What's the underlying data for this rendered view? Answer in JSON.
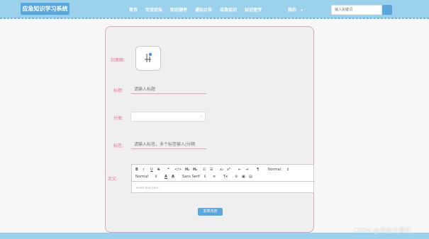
{
  "app": {
    "title": "应急知识学习系统"
  },
  "nav": {
    "items": [
      {
        "label": "首页"
      },
      {
        "label": "交流论坛"
      },
      {
        "label": "知识测考"
      },
      {
        "label": "通知公告"
      },
      {
        "label": "应急知识"
      },
      {
        "label": "知识宣传"
      }
    ],
    "mine_label": "我的",
    "mine_caret": "▼"
  },
  "search": {
    "placeholder": "输入关键词"
  },
  "form": {
    "cover_label": "封面图:",
    "title_label": "标题:",
    "title_placeholder": "请输入标题",
    "category_label": "分类:",
    "category_value": "",
    "tags_label": "标签:",
    "tags_placeholder": "请输入标签，多个标签输入|分隔",
    "body_label": "正文:",
    "submit_label": "发表内容"
  },
  "editor": {
    "toolbar_row1": {
      "bold": "B",
      "italic": "I",
      "underline": "U",
      "strike": "S",
      "quote": "❝",
      "code": "</>",
      "h1": "H₁",
      "h2": "H₂",
      "ordered_list": "☷",
      "bullet_list": "☰",
      "subscript": "x₂",
      "superscript": "x²",
      "indent_minus": "⇤",
      "indent_plus": "⇥",
      "direction": "¶",
      "header_select": "Normal"
    },
    "toolbar_row2": {
      "size_select": "Normal",
      "font_color": "A",
      "bg_color": "A",
      "font_select": "Sans Serif",
      "align": "≡",
      "clean": "Tx",
      "link": "🔗",
      "image": "▣",
      "video": "▤"
    },
    "placeholder": "Insert text here ..."
  },
  "watermark": "CSDN @伟庭大师兄",
  "colors": {
    "navbar": "#9cd1ec",
    "accent": "#5aa7dd",
    "label": "#e57096",
    "card_border": "#d9aab7"
  }
}
